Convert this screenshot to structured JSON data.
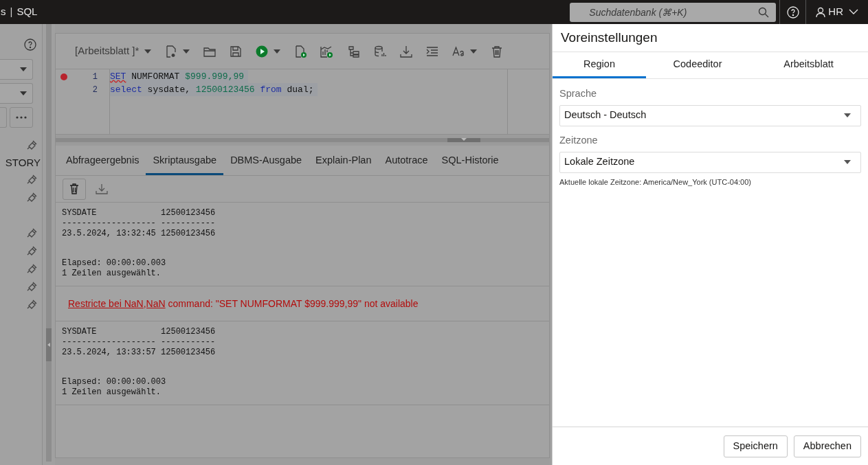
{
  "top_bar": {
    "breadcrumb": [
      "s",
      "SQL"
    ],
    "separator": "|",
    "search": {
      "placeholder": "Suchdatenbank (⌘+K)"
    },
    "user": "HR"
  },
  "sidebar": {
    "section_label": "STORY"
  },
  "worksheet": {
    "title": "[Arbeitsblatt ]*",
    "lines": [
      {
        "number": "1",
        "breakpoint": true,
        "tokens": [
          {
            "text": "SET",
            "kind": "keyword",
            "error": true
          },
          {
            "text": " NUMFORMAT ",
            "kind": "plain",
            "error": false
          },
          {
            "text": "$999.999,99",
            "kind": "number",
            "error": false
          }
        ]
      },
      {
        "number": "2",
        "breakpoint": false,
        "tokens": [
          {
            "text": "select",
            "kind": "keyword",
            "error": false
          },
          {
            "text": " sysdate, ",
            "kind": "plain",
            "error": false
          },
          {
            "text": "12500123456",
            "kind": "number",
            "error": false
          },
          {
            "text": " from",
            "kind": "keyword",
            "error": false
          },
          {
            "text": " dual;",
            "kind": "plain",
            "error": false
          }
        ]
      }
    ]
  },
  "result_tabs": [
    {
      "label": "Abfrageergebnis",
      "selected": false
    },
    {
      "label": "Skriptausgabe",
      "selected": true
    },
    {
      "label": "DBMS-Ausgabe",
      "selected": false
    },
    {
      "label": "Explain-Plan",
      "selected": false
    },
    {
      "label": "Autotrace",
      "selected": false
    },
    {
      "label": "SQL-Historie",
      "selected": false
    }
  ],
  "output": [
    {
      "kind": "result",
      "table": [
        "SYSDATE             12500123456",
        "------------------- -----------",
        "23.5.2024, 13:32:45 12500123456"
      ],
      "summary": [
        "Elapsed: 00:00:00.003",
        "1 Zeilen ausgewählt."
      ]
    },
    {
      "kind": "error",
      "link": "Restricte bei NaN,NaN",
      "message": "command: \"SET NUMFORMAT $999.999,99\" not available"
    },
    {
      "kind": "result",
      "table": [
        "SYSDATE             12500123456",
        "------------------- -----------",
        "23.5.2024, 13:33:57 12500123456"
      ],
      "summary": [
        "Elapsed: 00:00:00.003",
        "1 Zeilen ausgewählt."
      ]
    }
  ],
  "preferences": {
    "title": "Voreinstellungen",
    "tabs": [
      {
        "label": "Region",
        "selected": true
      },
      {
        "label": "Codeeditor",
        "selected": false
      },
      {
        "label": "Arbeitsblatt",
        "selected": false
      }
    ],
    "fields": [
      {
        "label": "Sprache",
        "value": "Deutsch - Deutsch"
      },
      {
        "label": "Zeitzone",
        "value": "Lokale Zeitzone"
      }
    ],
    "note": "Aktuelle lokale Zeitzone: America/New_York (UTC-04:00)",
    "buttons": [
      "Speichern",
      "Abbrechen"
    ]
  }
}
